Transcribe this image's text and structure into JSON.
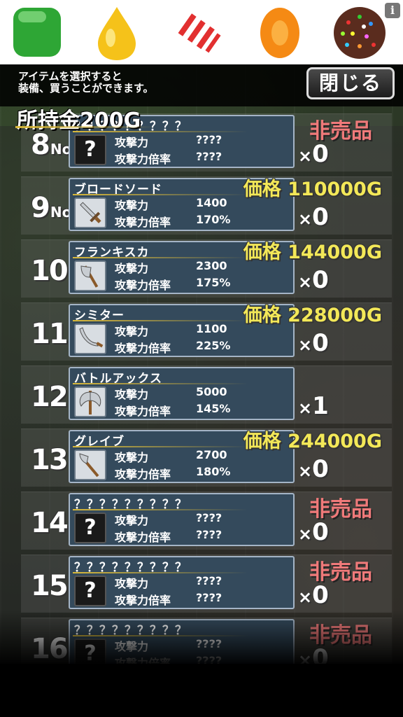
{
  "ad_banner": {
    "items": [
      {
        "icon": "green-square-candy-icon",
        "color": "#2ea635"
      },
      {
        "icon": "yellow-drop-candy-icon",
        "color": "#f5c21a"
      },
      {
        "icon": "striped-candy-icon",
        "color": "#e23030"
      },
      {
        "icon": "orange-round-candy-icon",
        "color": "#f58a14"
      },
      {
        "icon": "color-bomb-candy-icon",
        "color": "#5a2c1e"
      }
    ],
    "info_label": "i"
  },
  "header": {
    "hint": "アイテムを選択すると\n装備、買うことができます。",
    "close_label": "閉じる",
    "money_label": "所持金200G"
  },
  "labels": {
    "no": "No",
    "attack": "攻撃力",
    "attack_rate": "攻撃力倍率",
    "count_prefix": "×"
  },
  "colors": {
    "price": "#f3e858",
    "not_for_sale": "#f07a7a",
    "card_bg": "#344a5c",
    "card_border": "#a4b4c6"
  },
  "items": [
    {
      "no": "8",
      "name": "？？？？？？？？？",
      "icon": "unknown-item-icon",
      "attack": "????",
      "rate": "????",
      "count": "0",
      "price": "非売品",
      "for_sale": false
    },
    {
      "no": "9",
      "name": "ブロードソード",
      "icon": "broadsword-icon",
      "attack": "1400",
      "rate": "170%",
      "count": "0",
      "price": "価格 110000G",
      "for_sale": true
    },
    {
      "no": "10",
      "name": "フランキスカ",
      "icon": "axe-icon",
      "attack": "2300",
      "rate": "175%",
      "count": "0",
      "price": "価格 144000G",
      "for_sale": true
    },
    {
      "no": "11",
      "name": "シミター",
      "icon": "scimitar-icon",
      "attack": "1100",
      "rate": "225%",
      "count": "0",
      "price": "価格 228000G",
      "for_sale": true
    },
    {
      "no": "12",
      "name": "バトルアックス",
      "icon": "battle-axe-icon",
      "attack": "5000",
      "rate": "145%",
      "count": "1",
      "price": "",
      "for_sale": true
    },
    {
      "no": "13",
      "name": "グレイブ",
      "icon": "glaive-icon",
      "attack": "2700",
      "rate": "180%",
      "count": "0",
      "price": "価格 244000G",
      "for_sale": true
    },
    {
      "no": "14",
      "name": "？？？？？？？？？",
      "icon": "unknown-item-icon",
      "attack": "????",
      "rate": "????",
      "count": "0",
      "price": "非売品",
      "for_sale": false
    },
    {
      "no": "15",
      "name": "？？？？？？？？？",
      "icon": "unknown-item-icon",
      "attack": "????",
      "rate": "????",
      "count": "0",
      "price": "非売品",
      "for_sale": false
    },
    {
      "no": "16",
      "name": "？？？？？？？？？",
      "icon": "unknown-item-icon",
      "attack": "????",
      "rate": "????",
      "count": "0",
      "price": "非売品",
      "for_sale": false
    }
  ]
}
